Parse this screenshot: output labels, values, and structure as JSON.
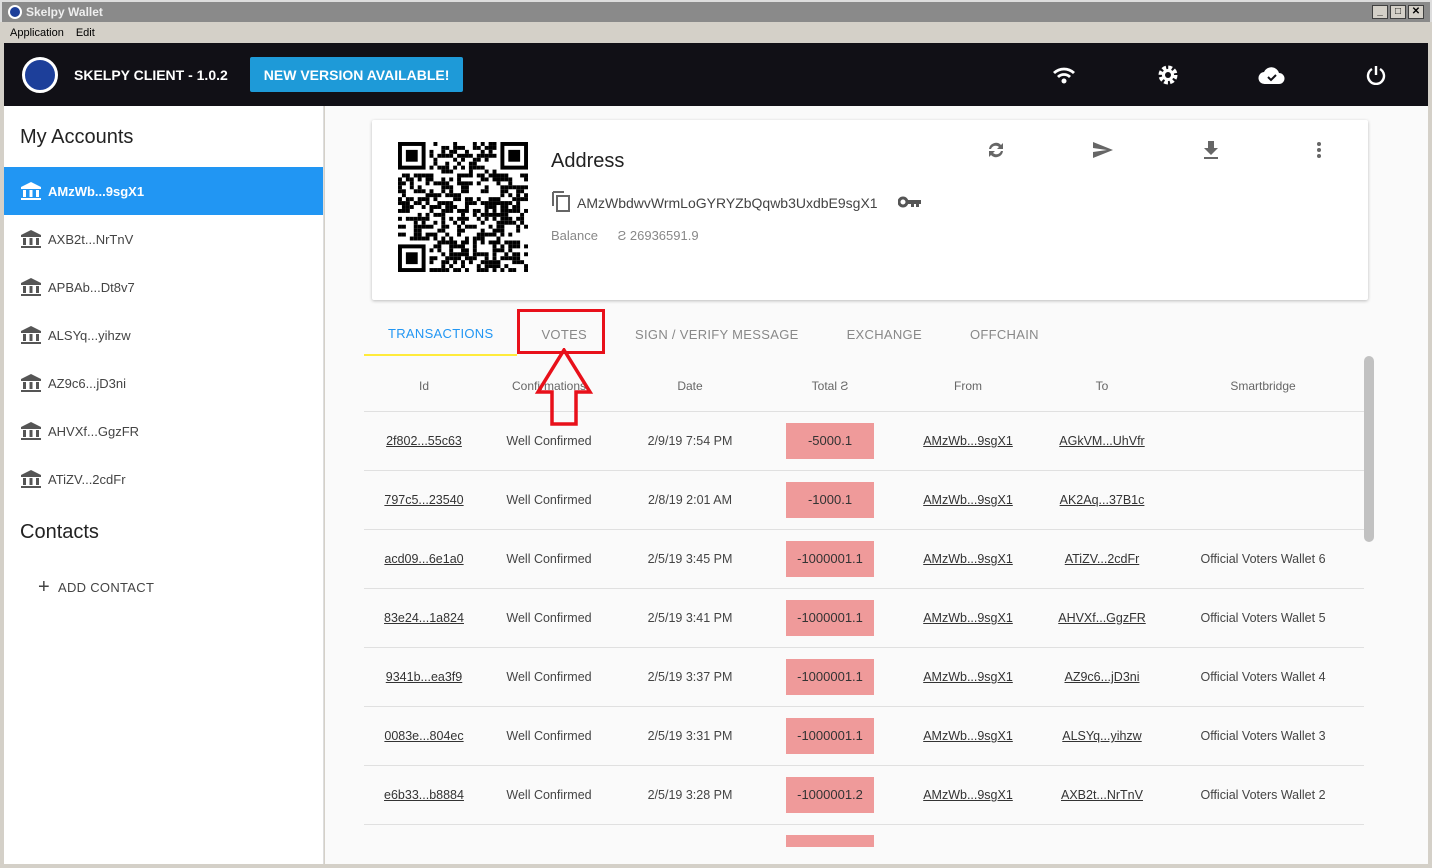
{
  "window": {
    "title": "Skelpy Wallet",
    "menu": [
      "Application",
      "Edit"
    ]
  },
  "header": {
    "title": "SKELPY CLIENT - 1.0.2",
    "new_version": "NEW VERSION AVAILABLE!"
  },
  "sidebar": {
    "accounts_title": "My Accounts",
    "accounts": [
      "AMzWb...9sgX1",
      "AXB2t...NrTnV",
      "APBAb...Dt8v7",
      "ALSYq...yihzw",
      "AZ9c6...jD3ni",
      "AHVXf...GgzFR",
      "ATiZV...2cdFr"
    ],
    "contacts_title": "Contacts",
    "add_contact": "ADD CONTACT"
  },
  "card": {
    "title": "Address",
    "address": "AMzWbdwvWrmLoGYRYZbQqwb3UxdbE9sgX1",
    "balance_label": "Balance",
    "balance": "Ƨ 26936591.9"
  },
  "tabs": [
    "TRANSACTIONS",
    "VOTES",
    "SIGN / VERIFY MESSAGE",
    "EXCHANGE",
    "OFFCHAIN"
  ],
  "table": {
    "headers": [
      "Id",
      "Confirmations",
      "Date",
      "Total Ƨ",
      "From",
      "To",
      "Smartbridge"
    ],
    "rows": [
      [
        "2f802...55c63",
        "Well Confirmed",
        "2/9/19 7:54 PM",
        "-5000.1",
        "AMzWb...9sgX1",
        "AGkVM...UhVfr",
        ""
      ],
      [
        "797c5...23540",
        "Well Confirmed",
        "2/8/19 2:01 AM",
        "-1000.1",
        "AMzWb...9sgX1",
        "AK2Aq...37B1c",
        ""
      ],
      [
        "acd09...6e1a0",
        "Well Confirmed",
        "2/5/19 3:45 PM",
        "-1000001.1",
        "AMzWb...9sgX1",
        "ATiZV...2cdFr",
        "Official Voters Wallet 6"
      ],
      [
        "83e24...1a824",
        "Well Confirmed",
        "2/5/19 3:41 PM",
        "-1000001.1",
        "AMzWb...9sgX1",
        "AHVXf...GgzFR",
        "Official Voters Wallet 5"
      ],
      [
        "9341b...ea3f9",
        "Well Confirmed",
        "2/5/19 3:37 PM",
        "-1000001.1",
        "AMzWb...9sgX1",
        "AZ9c6...jD3ni",
        "Official Voters Wallet 4"
      ],
      [
        "0083e...804ec",
        "Well Confirmed",
        "2/5/19 3:31 PM",
        "-1000001.1",
        "AMzWb...9sgX1",
        "ALSYq...yihzw",
        "Official Voters Wallet 3"
      ],
      [
        "e6b33...b8884",
        "Well Confirmed",
        "2/5/19 3:28 PM",
        "-1000001.2",
        "AMzWb...9sgX1",
        "AXB2t...NrTnV",
        "Official Voters Wallet 2"
      ]
    ]
  }
}
